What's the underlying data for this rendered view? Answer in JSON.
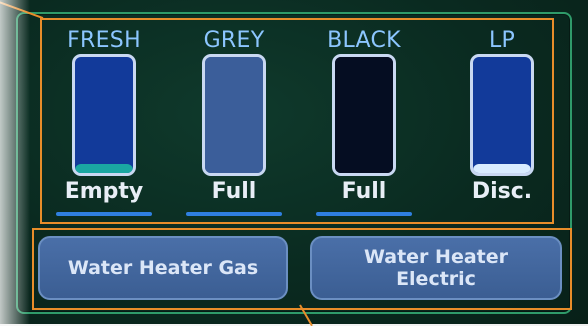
{
  "tanks": [
    {
      "label": "FRESH",
      "status": "Empty",
      "level": 0.08,
      "body_color": "#123a9a",
      "fill_color": "#1aa7a2"
    },
    {
      "label": "GREY",
      "status": "Full",
      "level": 1.0,
      "body_color": "#3b5e9a",
      "fill_color": "#3b5e9a"
    },
    {
      "label": "BLACK",
      "status": "Full",
      "level": 1.0,
      "body_color": "#050d22",
      "fill_color": "#050d22"
    },
    {
      "label": "LP",
      "status": "Disc.",
      "level": 0.08,
      "body_color": "#123a9a",
      "fill_color": "#d9ecff"
    }
  ],
  "buttons": {
    "water_heater_gas": "Water Heater Gas",
    "water_heater_electric": "Water Heater Electric"
  },
  "colors": {
    "screen_bg": "#0a2a20",
    "panel_border": "#2f9b6a",
    "annotation_border": "#e88d2a",
    "label_blue": "#8cc6ff",
    "underline_blue": "#2f7fe0"
  }
}
